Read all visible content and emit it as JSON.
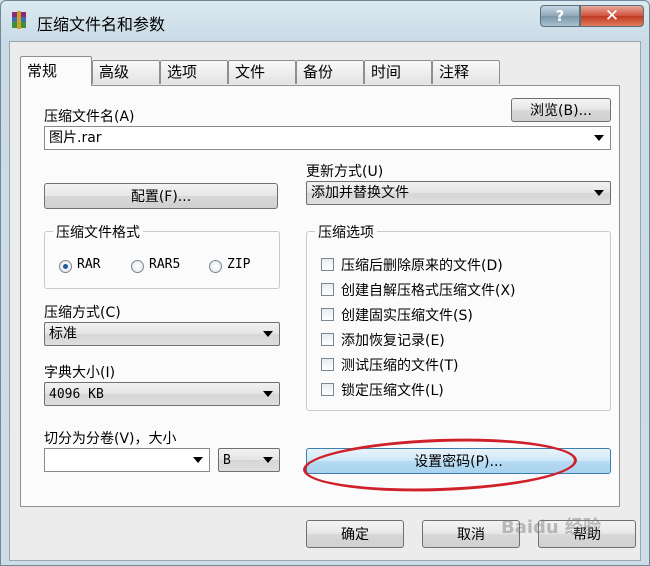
{
  "window": {
    "title": "压缩文件名和参数",
    "help_glyph": "?",
    "close_glyph": "✕"
  },
  "tabs": [
    {
      "label": "常规",
      "active": true
    },
    {
      "label": "高级"
    },
    {
      "label": "选项"
    },
    {
      "label": "文件"
    },
    {
      "label": "备份"
    },
    {
      "label": "时间"
    },
    {
      "label": "注释"
    }
  ],
  "general": {
    "archive_name_label": "压缩文件名(A)",
    "browse_label": "浏览(B)...",
    "archive_name_value": "图片.rar",
    "profiles_label": "配置(F)...",
    "update_mode_label": "更新方式(U)",
    "update_mode_value": "添加并替换文件",
    "format_group_label": "压缩文件格式",
    "formats": [
      {
        "label": "RAR",
        "selected": true
      },
      {
        "label": "RAR5",
        "selected": false
      },
      {
        "label": "ZIP",
        "selected": false
      }
    ],
    "method_label": "压缩方式(C)",
    "method_value": "标准",
    "dict_label": "字典大小(I)",
    "dict_value": "4096 KB",
    "split_label": "切分为分卷(V)，大小",
    "split_value": "",
    "split_unit": "B",
    "options_group_label": "压缩选项",
    "options": [
      {
        "label": "压缩后删除原来的文件(D)",
        "checked": false
      },
      {
        "label": "创建自解压格式压缩文件(X)",
        "checked": false
      },
      {
        "label": "创建固实压缩文件(S)",
        "checked": false
      },
      {
        "label": "添加恢复记录(E)",
        "checked": false
      },
      {
        "label": "测试压缩的文件(T)",
        "checked": false
      },
      {
        "label": "锁定压缩文件(L)",
        "checked": false
      }
    ],
    "set_password_label": "设置密码(P)..."
  },
  "footer": {
    "ok_label": "确定",
    "cancel_label": "取消",
    "help_label": "帮助"
  },
  "watermark": "Baidu 经验",
  "colors": {
    "highlight_oval": "#d0202a",
    "focus_border": "#3c7fb1"
  }
}
